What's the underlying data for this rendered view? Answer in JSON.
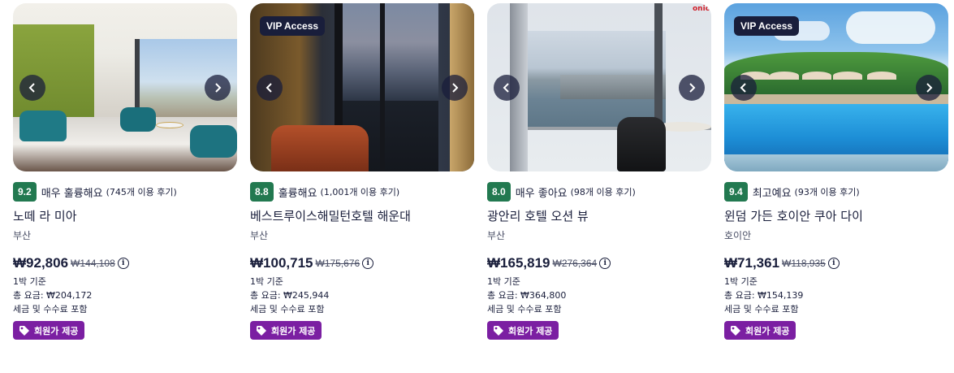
{
  "cards": [
    {
      "vip": "",
      "score": "9.2",
      "rating_label": "매우 훌륭해요",
      "review_count": "(745개 이용 후기)",
      "name": "노떼 라 미아",
      "location": "부산",
      "price": "₩92,806",
      "old_price": "₩144,108",
      "per_night": "1박 기준",
      "total": "총 요금: ₩204,172",
      "tax_note": "세금 및 수수료 포함",
      "member_tag": "회원가 제공"
    },
    {
      "vip": "VIP Access",
      "score": "8.8",
      "rating_label": "훌륭해요",
      "review_count": "(1,001개 이용 후기)",
      "name": "베스트루이스해밀턴호텔 해운대",
      "location": "부산",
      "price": "₩100,715",
      "old_price": "₩175,676",
      "per_night": "1박 기준",
      "total": "총 요금: ₩245,944",
      "tax_note": "세금 및 수수료 포함",
      "member_tag": "회원가 제공"
    },
    {
      "vip": "",
      "score": "8.0",
      "rating_label": "매우 좋아요",
      "review_count": "(98개 이용 후기)",
      "name": "광안리 호텔 오션 뷰",
      "location": "부산",
      "price": "₩165,819",
      "old_price": "₩276,364",
      "per_night": "1박 기준",
      "total": "총 요금: ₩364,800",
      "tax_note": "세금 및 수수료 포함",
      "member_tag": "회원가 제공",
      "photo_logo": "onic"
    },
    {
      "vip": "VIP Access",
      "score": "9.4",
      "rating_label": "최고예요",
      "review_count": "(93개 이용 후기)",
      "name": "윈덤 가든 호이안 쿠아 다이",
      "location": "호이안",
      "price": "₩71,361",
      "old_price": "₩118,935",
      "per_night": "1박 기준",
      "total": "총 요금: ₩154,139",
      "tax_note": "세금 및 수수료 포함",
      "member_tag": "회원가 제공"
    }
  ],
  "icons": {
    "prev": "chevron-left-icon",
    "next": "chevron-right-icon",
    "info": "info-icon",
    "tag": "tag-icon"
  },
  "colors": {
    "score_bg": "#227950",
    "member_tag_bg": "#7b1fa2",
    "vip_bg": "#191e3b",
    "text": "#191e3b"
  }
}
